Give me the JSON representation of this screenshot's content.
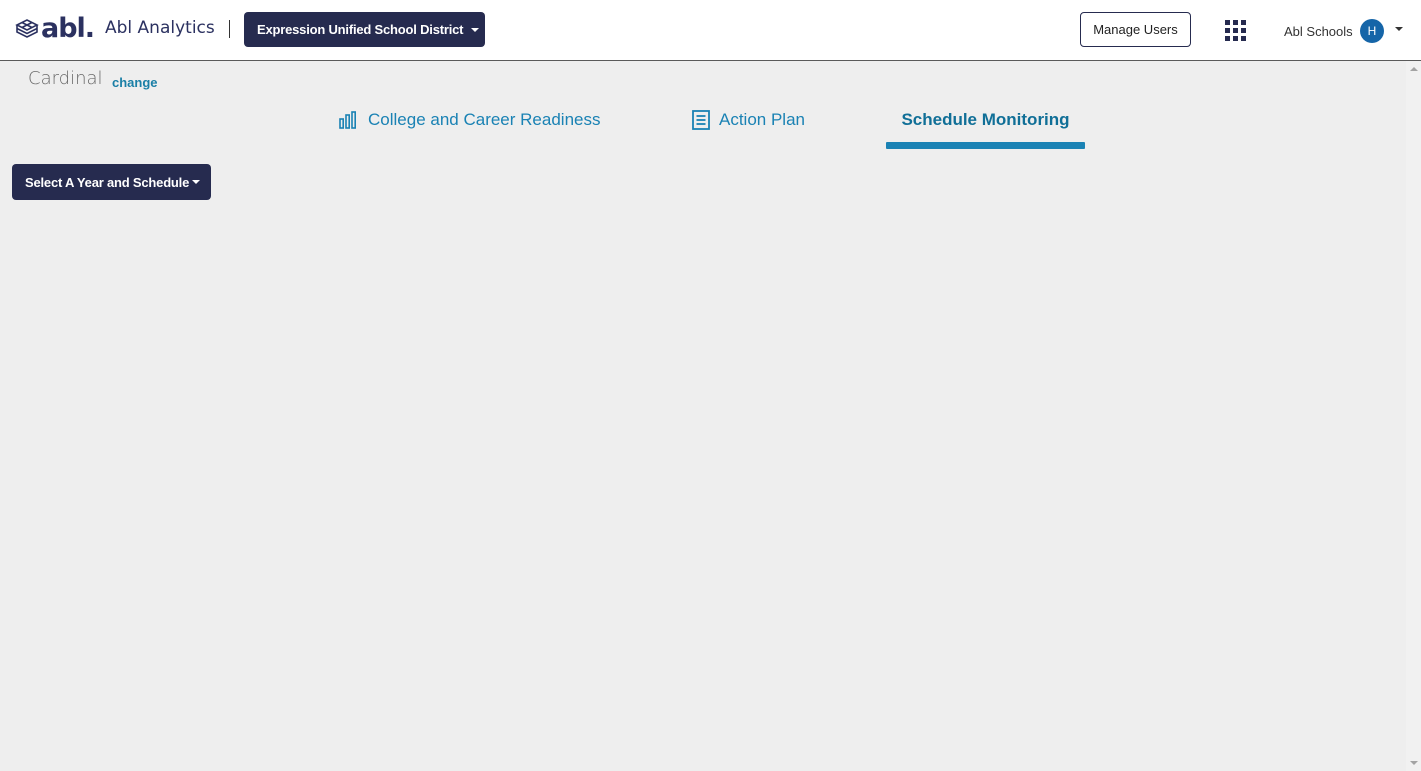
{
  "header": {
    "logo_text": "abl.",
    "app_title": "Abl Analytics",
    "district_selector_label": "Expression Unified School District",
    "manage_users_label": "Manage Users",
    "apps_icon": "apps-grid-icon",
    "org_name": "Abl Schools",
    "avatar_initial": "H"
  },
  "school": {
    "name": "Cardinal",
    "change_label": "change"
  },
  "tabs": [
    {
      "label": "College and Career Readiness",
      "icon": "bar-chart-icon",
      "active": false
    },
    {
      "label": "Action Plan",
      "icon": "document-list-icon",
      "active": false
    },
    {
      "label": "Schedule Monitoring",
      "active": true
    }
  ],
  "controls": {
    "year_schedule_label": "Select A Year and Schedule"
  },
  "colors": {
    "navy": "#262b4f",
    "accent_blue": "#1a82b4",
    "page_background": "#eeeeee"
  }
}
